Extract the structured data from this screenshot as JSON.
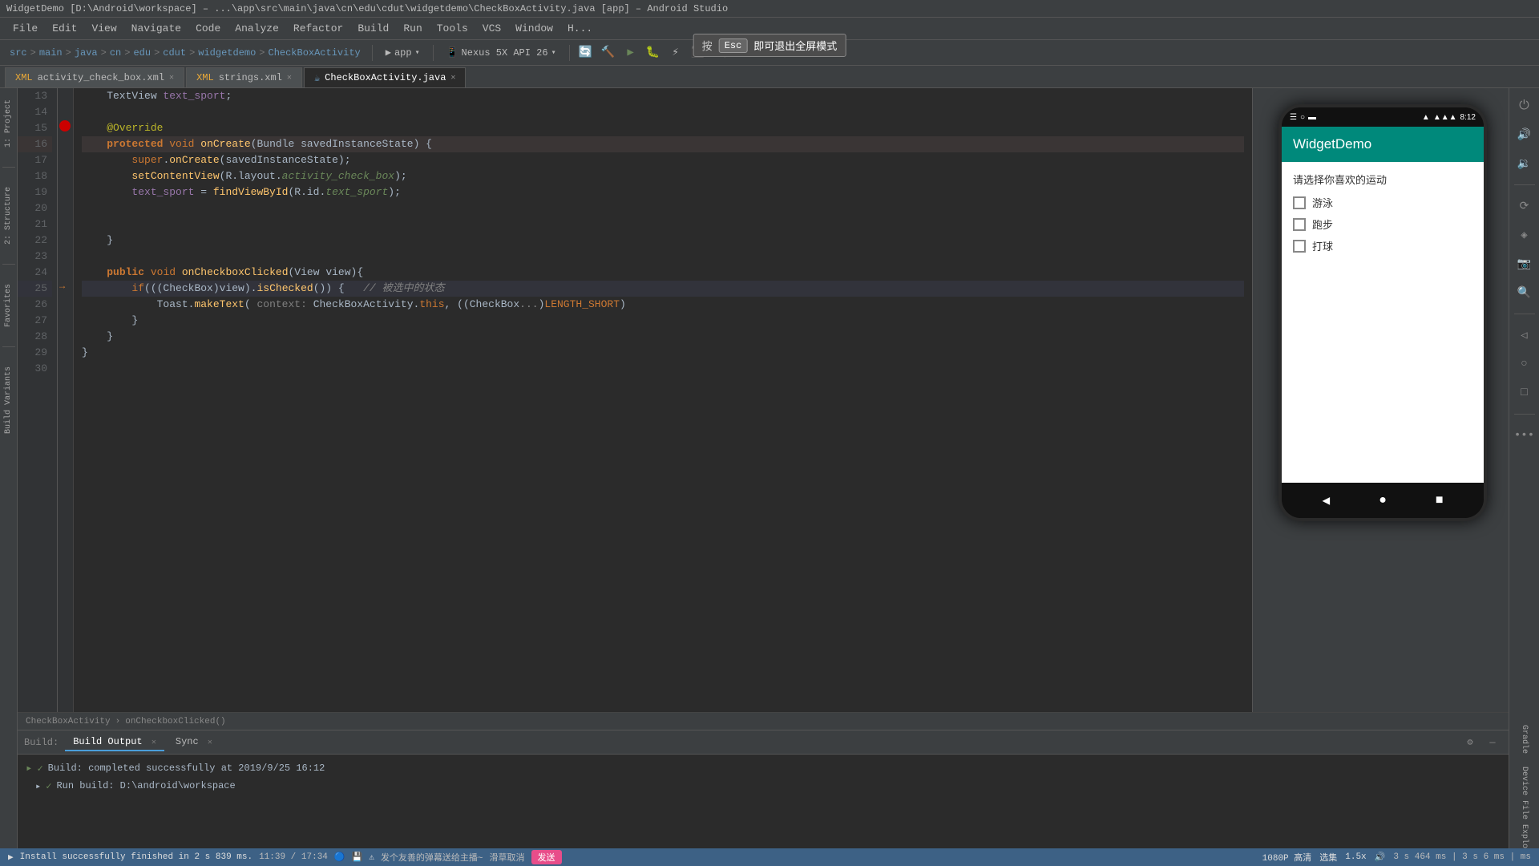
{
  "title_bar": {
    "text": "WidgetDemo [D:\\Android\\workspace] – ...\\app\\src\\main\\java\\cn\\edu\\cdut\\widgetdemo\\CheckBoxActivity.java [app] – Android Studio"
  },
  "menu": {
    "items": [
      "File",
      "Edit",
      "View",
      "Navigate",
      "Code",
      "Analyze",
      "Refactor",
      "Build",
      "Run",
      "Tools",
      "VCS",
      "Window",
      "H..."
    ]
  },
  "breadcrumb": {
    "parts": [
      "src",
      "main",
      "java",
      "cn",
      "edu",
      "cdut",
      "widgetdemo",
      "CheckBoxActivity"
    ]
  },
  "tabs": [
    {
      "label": "activity_check_box.xml",
      "icon": "xml",
      "active": false
    },
    {
      "label": "strings.xml",
      "icon": "xml",
      "active": false
    },
    {
      "label": "CheckBoxActivity.java",
      "icon": "java",
      "active": true
    }
  ],
  "code": {
    "lines": [
      {
        "num": 13,
        "content": "    TextView text_sport;"
      },
      {
        "num": 14,
        "content": ""
      },
      {
        "num": 15,
        "content": "    @Override"
      },
      {
        "num": 16,
        "content": "    protected void onCreate(Bundle savedInstanceState) {",
        "breakpoint": true
      },
      {
        "num": 17,
        "content": "        super.onCreate(savedInstanceState);"
      },
      {
        "num": 18,
        "content": "        setContentView(R.layout.activity_check_box);"
      },
      {
        "num": 19,
        "content": "        text_sport = findViewById(R.id.text_sport);"
      },
      {
        "num": 20,
        "content": ""
      },
      {
        "num": 21,
        "content": ""
      },
      {
        "num": 22,
        "content": "    }"
      },
      {
        "num": 23,
        "content": ""
      },
      {
        "num": 24,
        "content": "    public void onCheckboxClicked(View view){"
      },
      {
        "num": 25,
        "content": "        if(((CheckBox)view).isChecked()) {   //被选中的状态",
        "highlighted": true
      },
      {
        "num": 26,
        "content": "            Toast.makeText( context: CheckBoxActivity.this, ((CheckBox..."
      },
      {
        "num": 27,
        "content": "        }"
      },
      {
        "num": 28,
        "content": "    }"
      },
      {
        "num": 29,
        "content": "}"
      },
      {
        "num": 30,
        "content": ""
      }
    ]
  },
  "editor_breadcrumb": {
    "class": "CheckBoxActivity",
    "method": "onCheckboxClicked()"
  },
  "bottom_tabs": [
    {
      "label": "Build",
      "active": false
    },
    {
      "label": "Build Output",
      "active": true
    },
    {
      "label": "Sync",
      "active": false
    }
  ],
  "build_output": [
    {
      "type": "ok",
      "text": "Build: completed successfully at 2019/9/25 16:12"
    },
    {
      "type": "ok",
      "text": "Run build: D:\\android\\workspace"
    }
  ],
  "status_bar": {
    "left": "Install successfully finished in 2 s 839 ms.",
    "time": "11:39 / 17:34",
    "resolution": "1080P 高清",
    "select": "选集",
    "zoom": "1.5x",
    "right_text": "3 s 464 ms | 3 s 6 ms | ms"
  },
  "phone": {
    "app_title": "WidgetDemo",
    "status_time": "8:12",
    "content_title": "请选择你喜欢的运动",
    "checkboxes": [
      "游泳",
      "跑步",
      "打球"
    ],
    "nav": [
      "◀",
      "●",
      "■"
    ]
  },
  "tooltip": {
    "key": "Esc",
    "text": "即可退出全屏模式"
  },
  "sidebar_labels": [
    "1: Project",
    "2: Structure",
    "Favorites",
    "Build Variants"
  ],
  "right_sidebar_labels": [
    "Gradle",
    "Device File Explorer"
  ]
}
